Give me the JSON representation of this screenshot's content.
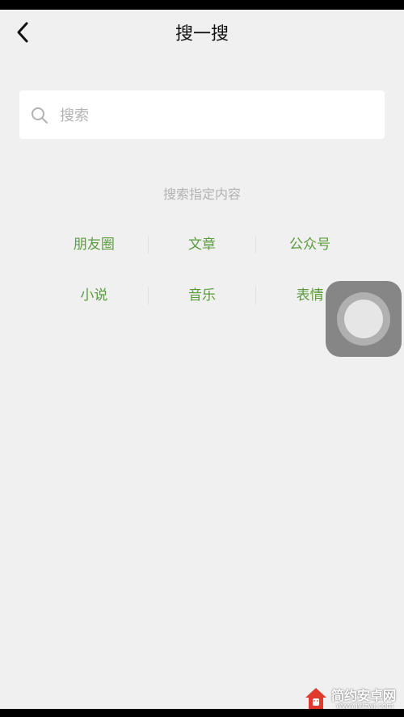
{
  "header": {
    "title": "搜一搜"
  },
  "search": {
    "placeholder": "搜索"
  },
  "hint": "搜索指定内容",
  "categories": {
    "row1": [
      "朋友圈",
      "文章",
      "公众号"
    ],
    "row2": [
      "小说",
      "音乐",
      "表情"
    ]
  },
  "watermark": {
    "name": "简约安卓网",
    "url": "www.jylzwj.com"
  },
  "colors": {
    "accent": "#5b9b3f",
    "background": "#f0f0f0",
    "hint": "#b2b2b2"
  }
}
